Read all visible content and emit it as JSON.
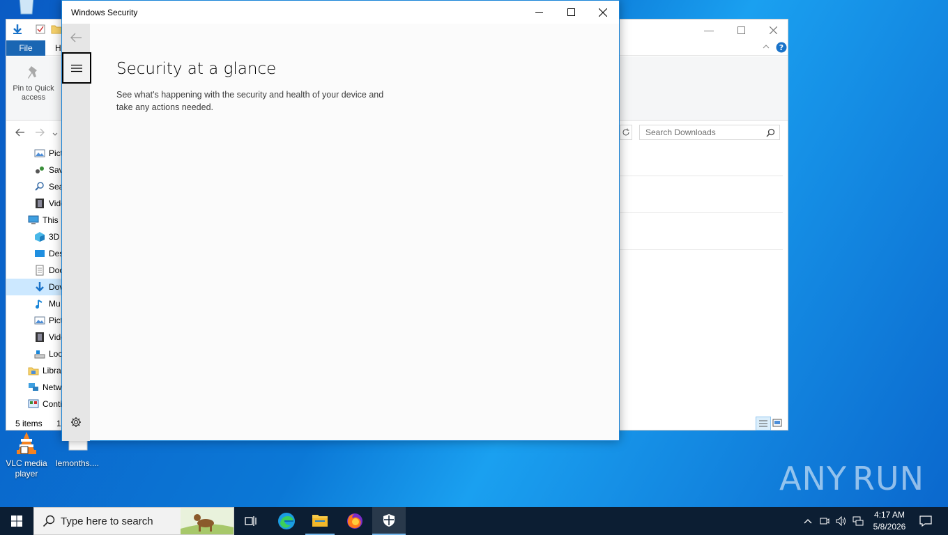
{
  "desktop": {
    "icons": [
      {
        "label": "VLC media player"
      },
      {
        "label": "lemonths...."
      }
    ],
    "watermark": {
      "left": "ANY",
      "right": "RUN"
    }
  },
  "explorer": {
    "file_tab": "File",
    "home_tab_partial": "H",
    "pin_label": "Pin to Quick access",
    "search_placeholder": "Search Downloads",
    "nav_items": [
      {
        "label": "Pict",
        "icon": "pictures-icon"
      },
      {
        "label": "Sav",
        "icon": "saved-games-icon"
      },
      {
        "label": "Sea",
        "icon": "searches-icon"
      },
      {
        "label": "Vide",
        "icon": "videos-icon"
      },
      {
        "label": "This I",
        "icon": "this-pc-icon"
      },
      {
        "label": "3D (",
        "icon": "3d-objects-icon"
      },
      {
        "label": "Des",
        "icon": "desktop-folder-icon"
      },
      {
        "label": "Doc",
        "icon": "documents-icon"
      },
      {
        "label": "Dov",
        "icon": "downloads-icon"
      },
      {
        "label": "Mu",
        "icon": "music-icon"
      },
      {
        "label": "Pict",
        "icon": "pictures-icon"
      },
      {
        "label": "Vide",
        "icon": "videos-icon"
      },
      {
        "label": "Loc",
        "icon": "local-disk-icon"
      },
      {
        "label": "Libra",
        "icon": "libraries-icon"
      },
      {
        "label": "Netw",
        "icon": "network-icon"
      },
      {
        "label": "Conti",
        "icon": "control-panel-icon"
      }
    ],
    "status_items": "5 items",
    "status_partial": "1"
  },
  "security_window": {
    "title": "Windows Security",
    "heading": "Security at a glance",
    "subtitle": "See what's happening with the security and health of your device and take any actions needed."
  },
  "taskbar": {
    "search_placeholder": "Type here to search",
    "time": "4:17 AM",
    "date": "5/8/2026",
    "accent": "#76b9ed"
  }
}
